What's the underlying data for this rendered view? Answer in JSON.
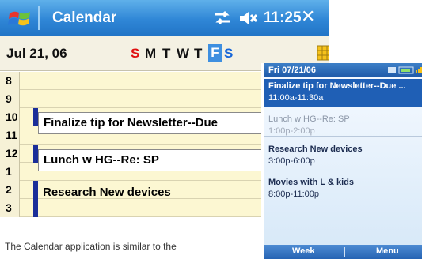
{
  "pocketpc": {
    "title": "Calendar",
    "clock": "11:25",
    "close_glyph": "✕",
    "date": "Jul  21, 06",
    "weekdays": [
      "S",
      "M",
      "T",
      "W",
      "T",
      "F",
      "S"
    ],
    "selected_weekday_index": 5,
    "hours": [
      "8",
      "9",
      "10",
      "11",
      "12",
      "1",
      "2",
      "3"
    ],
    "appointments": [
      {
        "title": "Finalize tip for Newsletter--Due"
      },
      {
        "title": "Lunch w HG--Re: SP"
      },
      {
        "title": "Research New devices"
      }
    ],
    "icons": [
      "windows-start-icon",
      "connectivity-icon",
      "volume-icon",
      "close-icon",
      "grid-icon"
    ]
  },
  "caption": "The Calendar application is similar to the",
  "smartphone": {
    "title": "Fri 07/21/06",
    "items": [
      {
        "title": "Finalize tip for Newsletter--Due ...",
        "time": "11:00a-11:30a",
        "selected": true
      },
      {
        "title": "Lunch w HG--Re: SP",
        "time": "1:00p-2:00p",
        "past": true
      },
      {
        "title": "Research New devices",
        "time": "3:00p-6:00p"
      },
      {
        "title": "Movies with L & kids",
        "time": "8:00p-11:00p"
      }
    ],
    "softkey_left": "Week",
    "softkey_right": "Menu",
    "icons": [
      "signal-icon",
      "battery-icon"
    ]
  },
  "colors": {
    "titlebar": "#2f86d6",
    "datebar": "#f4f1e3",
    "grid_row": "#fcf7d2",
    "sunday": "#e01010",
    "saturday": "#1565d8",
    "selected_day": "#3e8fe0",
    "appointment_bar": "#1a2e99",
    "smartphone_highlight": "#1f5fb5"
  }
}
